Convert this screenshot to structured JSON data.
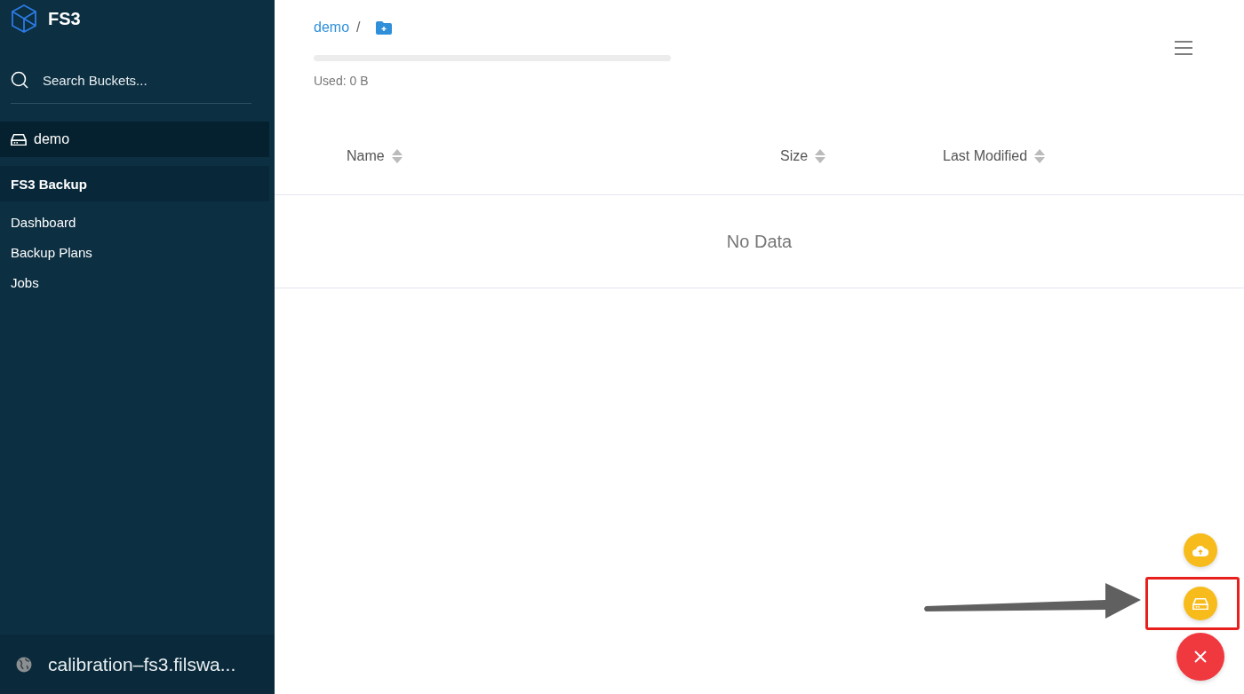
{
  "sidebar": {
    "logo": "FS3",
    "search": {
      "placeholder": "Search Buckets..."
    },
    "buckets": [
      {
        "label": "demo",
        "selected": true
      }
    ],
    "section": "FS3 Backup",
    "items": [
      {
        "label": "Dashboard"
      },
      {
        "label": "Backup Plans"
      },
      {
        "label": "Jobs"
      }
    ],
    "footer": "calibration–fs3.filswa..."
  },
  "breadcrumb": {
    "bucket": "demo",
    "separator": "/"
  },
  "storage": {
    "level": 0,
    "label": "Used: 0 B"
  },
  "table": {
    "columns": [
      "Name",
      "Size",
      "Last Modified"
    ],
    "empty": "No Data"
  },
  "fabs": [
    {
      "kind": "upload",
      "highlighted": false
    },
    {
      "kind": "bucket",
      "highlighted": true
    },
    {
      "kind": "close",
      "highlighted": false
    }
  ]
}
